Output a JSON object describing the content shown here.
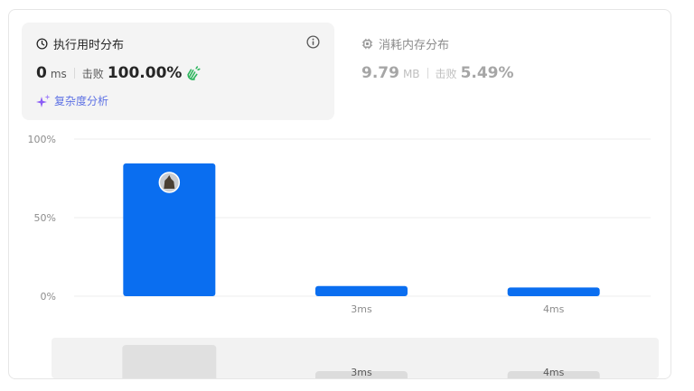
{
  "runtime": {
    "title": "执行用时分布",
    "value": "0",
    "unit": "ms",
    "beats_label": "击败",
    "beats_value": "100.00%",
    "analysis_label": "复杂度分析"
  },
  "memory": {
    "title": "消耗内存分布",
    "value": "9.79",
    "unit": "MB",
    "beats_label": "击败",
    "beats_value": "5.49%"
  },
  "colors": {
    "bar": "#0a6ef0",
    "grid": "#ececec",
    "axis_text": "#8c8c8c",
    "overview_bg": "#f2f2f2",
    "overview_bar_selected": "#e0e0e0",
    "overview_bar": "#dcdcdc",
    "hands_icon": "#2db55d",
    "sparkle_icon": "#8b5cf6"
  },
  "icons": {
    "runtime": "clock-icon",
    "memory": "chip-icon",
    "info": "info-icon",
    "beats": "clapping-hands-icon",
    "analysis": "sparkle-icon",
    "user_marker": "avatar-icon"
  },
  "chart_data": {
    "type": "bar",
    "categories": [
      "",
      "3ms",
      "4ms"
    ],
    "values": [
      84.5,
      6.5,
      5.5
    ],
    "y_ticks": [
      "0%",
      "50%",
      "100%"
    ],
    "ylim": [
      0,
      100
    ],
    "grid": true,
    "highlight_index": 0,
    "overview_labels": [
      "",
      "3ms",
      "4ms"
    ]
  }
}
